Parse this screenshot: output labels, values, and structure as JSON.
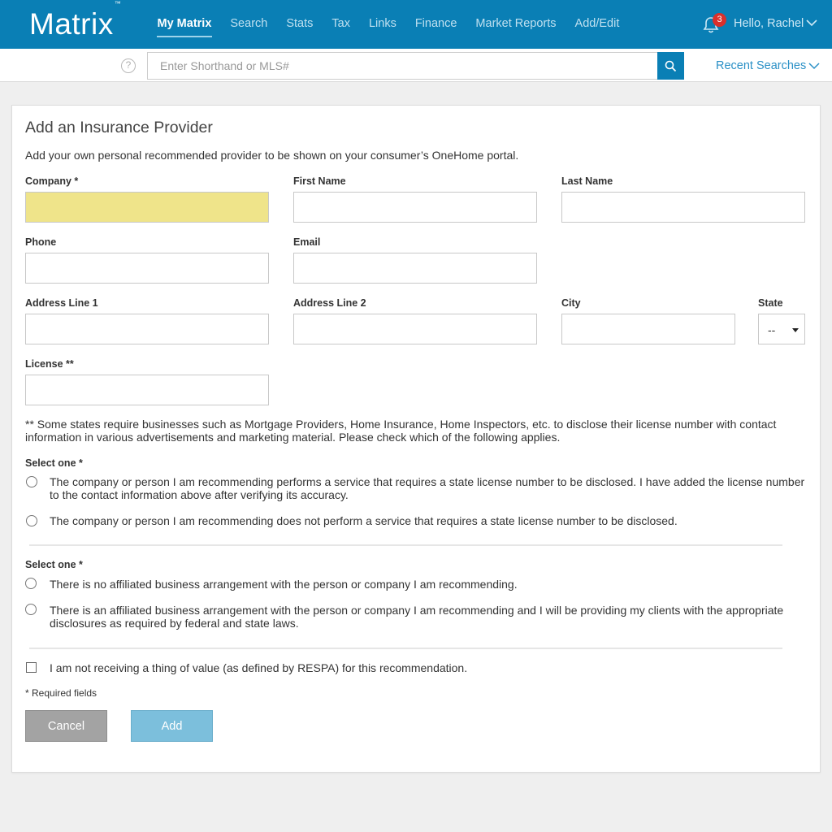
{
  "header": {
    "logo": "Matrix",
    "logo_tm": "™",
    "nav": [
      "My Matrix",
      "Search",
      "Stats",
      "Tax",
      "Links",
      "Finance",
      "Market Reports",
      "Add/Edit"
    ],
    "active_nav": "My Matrix",
    "notification_count": "3",
    "greeting": "Hello, Rachel",
    "brand_color": "#0a7fb5"
  },
  "subbar": {
    "help_glyph": "?",
    "search_placeholder": "Enter Shorthand or MLS#",
    "recent_searches": "Recent Searches"
  },
  "form": {
    "title": "Add an Insurance Provider",
    "intro": "Add your own personal recommended provider to be shown on your consumer’s OneHome portal.",
    "labels": {
      "company": "Company *",
      "first_name": "First Name",
      "last_name": "Last Name",
      "phone": "Phone",
      "email": "Email",
      "address1": "Address Line 1",
      "address2": "Address Line 2",
      "city": "City",
      "state": "State",
      "license": "License **"
    },
    "values": {
      "company": "",
      "first_name": "",
      "last_name": "",
      "phone": "",
      "email": "",
      "address1": "",
      "address2": "",
      "city": "",
      "license": ""
    },
    "state_selected": "--",
    "license_note": "** Some states require businesses such as Mortgage Providers, Home Insurance, Home Inspectors, etc. to disclose their license number with contact information in various advertisements and marketing material.  Please check which of the following applies.",
    "group1": {
      "label": "Select one *",
      "options": [
        "The company or person I am recommending performs a service that requires a state license number to be disclosed.  I have added the license number to the contact information above after verifying its accuracy.",
        "The company or person I am recommending does not perform a service that requires a state license number to be disclosed."
      ]
    },
    "group2": {
      "label": "Select one *",
      "options": [
        "There is no affiliated business arrangement with the person or company I am recommending.",
        "There is an affiliated business arrangement with the person or company I am recommending and I will be providing my clients with the appropriate disclosures as required by federal and state laws."
      ]
    },
    "respa_checkbox": "I am not receiving a thing of value (as defined by RESPA) for this recommendation.",
    "required_note": "* Required fields",
    "cancel_label": "Cancel",
    "add_label": "Add",
    "highlight_color": "#efe48a"
  }
}
